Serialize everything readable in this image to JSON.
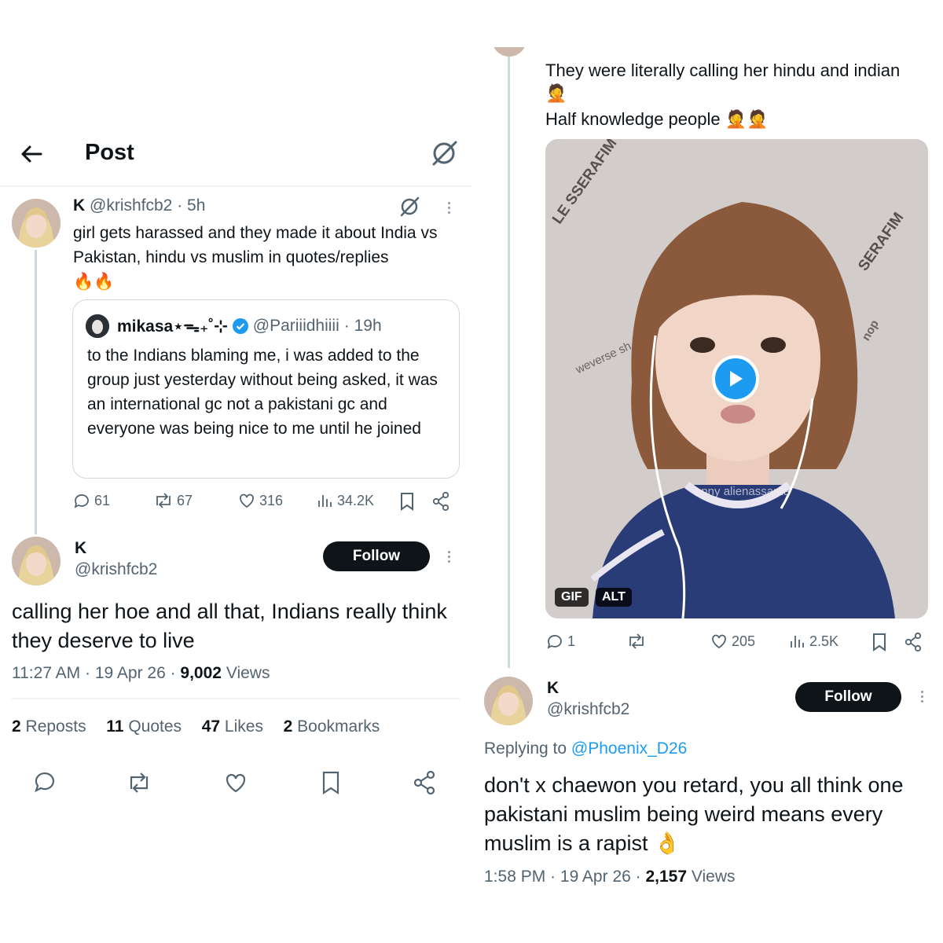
{
  "left": {
    "header": {
      "title": "Post"
    },
    "quoting_post": {
      "name": "K",
      "handle": "@krishfcb2",
      "time": "· 5h",
      "text": "girl gets harassed and they made it about India vs Pakistan, hindu vs muslim in quotes/replies",
      "emoji": "🔥🔥",
      "quoted": {
        "name": "mikasa⋆ᯓ₊˚⊹",
        "handle": "@Pariiidhiiii",
        "time": "· 19h",
        "text": "to the Indians blaming me, i was added to the group just yesterday without being asked, it was an international gc not a pakistani gc and everyone was being nice to me until he joined"
      },
      "stats": {
        "replies": "61",
        "reposts": "67",
        "likes": "316",
        "views": "34.2K"
      }
    },
    "main_post": {
      "name": "K",
      "handle": "@krishfcb2",
      "follow_label": "Follow",
      "text": "calling her hoe and all that, Indians really think they deserve to live",
      "time": "11:27 AM",
      "date": "19 Apr 26",
      "views_count": "9,002",
      "views_label": "Views",
      "engagement": {
        "reposts": "2",
        "reposts_label": "Reposts",
        "quotes": "11",
        "quotes_label": "Quotes",
        "likes": "47",
        "likes_label": "Likes",
        "bookmarks": "2",
        "bookmarks_label": "Bookmarks"
      }
    }
  },
  "right": {
    "top_post": {
      "text_line1": "They were literally calling her hindu and indian",
      "emoji_line2": "🤦",
      "text_line3": "Half knowledge people",
      "emoji_line3": "🤦🤦",
      "media": {
        "badge_gif": "GIF",
        "badge_alt": "ALT",
        "backdrop_text_1": "LE SSERAFIM",
        "backdrop_text_2": "SERAFIM",
        "backdrop_text_3": "weverse sh",
        "backdrop_text_4": "nop",
        "backdrop_text_5": "anny alienassante"
      },
      "stats": {
        "replies": "1",
        "reposts": "",
        "likes": "205",
        "views": "2.5K"
      }
    },
    "reply_post": {
      "name": "K",
      "handle": "@krishfcb2",
      "follow_label": "Follow",
      "replying_prefix": "Replying to",
      "replying_handle": "@Phoenix_D26",
      "text": "don't x chaewon you retard, you all think one pakistani muslim being weird means every muslim is a rapist",
      "emoji": "👌",
      "time": "1:58 PM",
      "date": "19 Apr 26",
      "views_count": "2,157",
      "views_label": "Views"
    }
  },
  "colors": {
    "accent": "#1d9bf0",
    "text": "#0f1419",
    "muted": "#536471",
    "border": "#eff3f4"
  }
}
